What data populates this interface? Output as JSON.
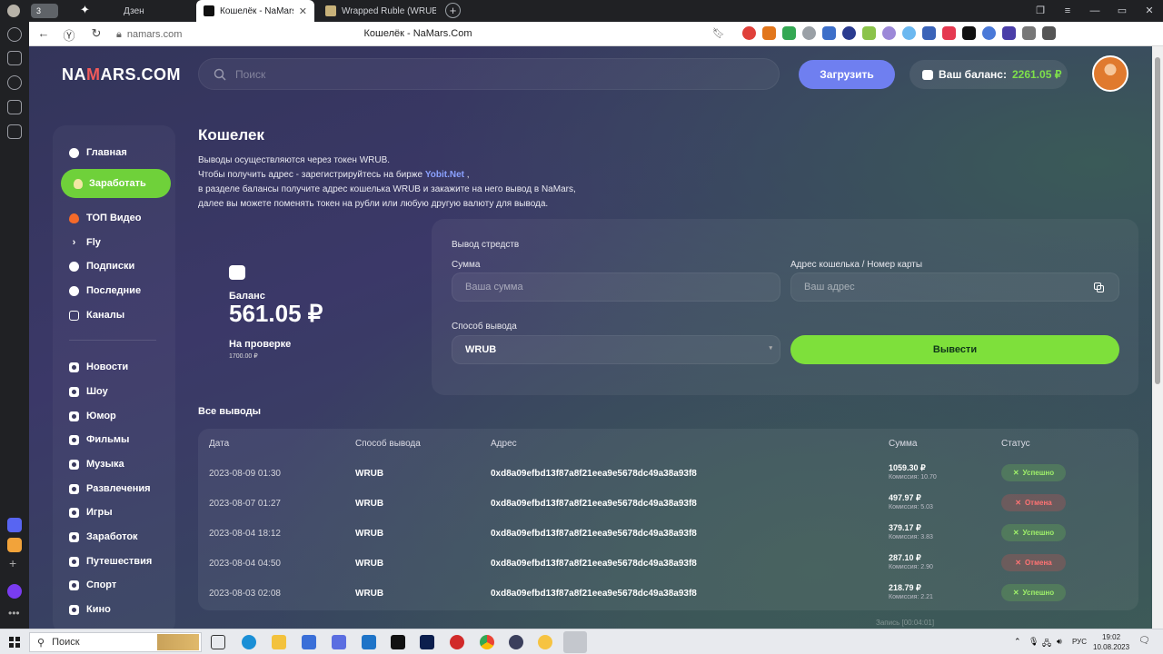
{
  "browser": {
    "tab_count": "3",
    "tabs": [
      {
        "title": "Дзен"
      },
      {
        "title": "Кошелёк - NaMars.Com"
      },
      {
        "title": "Wrapped Ruble (WRUB) To"
      }
    ],
    "url": "namars.com",
    "page_title": "Кошелёк - NaMars.Com"
  },
  "header": {
    "logo_prefix": "NA",
    "logo_accent": "M",
    "logo_suffix": "ARS.COM",
    "search_placeholder": "Поиск",
    "upload_label": "Загрузить",
    "balance_label": "Ваш баланс:",
    "balance_value": "2261.05 ₽"
  },
  "sidebar": {
    "items": [
      {
        "label": "Главная",
        "icon": "home-icon"
      },
      {
        "label": "Заработать",
        "icon": "money-bag-icon"
      },
      {
        "label": "ТОП Видео",
        "icon": "fire-icon"
      },
      {
        "label": "Fly",
        "icon": "chevron-right-icon"
      },
      {
        "label": "Подписки",
        "icon": "subscriptions-icon"
      },
      {
        "label": "Последние",
        "icon": "clock-icon"
      },
      {
        "label": "Каналы",
        "icon": "channels-icon"
      }
    ],
    "categories": [
      "Новости",
      "Шоу",
      "Юмор",
      "Фильмы",
      "Музыка",
      "Развлечения",
      "Игры",
      "Заработок",
      "Путешествия",
      "Спорт",
      "Кино"
    ]
  },
  "main": {
    "title": "Кошелек",
    "desc_1": "Выводы осуществляются через токен WRUB.",
    "desc_2a": "Чтобы получить адрес - зарегистрируйтесь на бирже",
    "desc_2_link": "Yobit.Net",
    "desc_2b": ",",
    "desc_3": "в разделе балансы получите адрес кошелька WRUB и закажите на него вывод в NaMars,",
    "desc_4": "далее вы можете поменять токен на рубли или любую другую валюту для вывода.",
    "balance_label": "Баланс",
    "balance_value": "561.05 ₽",
    "check_label": "На проверке",
    "check_value": "1700.00 ₽"
  },
  "withdraw": {
    "title": "Вывод стредств",
    "amount_label": "Сумма",
    "amount_placeholder": "Ваша сумма",
    "address_label": "Адрес кошелька / Номер карты",
    "address_placeholder": "Ваш адрес",
    "method_label": "Способ вывода",
    "method_value": "WRUB",
    "submit_label": "Вывести"
  },
  "history": {
    "title": "Все выводы",
    "columns": [
      "Дата",
      "Способ вывода",
      "Адрес",
      "Сумма",
      "Статус"
    ],
    "rows": [
      {
        "date": "2023-08-09 01:30",
        "method": "WRUB",
        "address": "0xd8a09efbd13f87a8f21eea9e5678dc49a38a93f8",
        "amount": "1059.30 ₽",
        "fee": "Комиссия: 10.70",
        "status": "Успешно",
        "ok": true
      },
      {
        "date": "2023-08-07 01:27",
        "method": "WRUB",
        "address": "0xd8a09efbd13f87a8f21eea9e5678dc49a38a93f8",
        "amount": "497.97 ₽",
        "fee": "Комиссия: 5.03",
        "status": "Отмена",
        "ok": false
      },
      {
        "date": "2023-08-04 18:12",
        "method": "WRUB",
        "address": "0xd8a09efbd13f87a8f21eea9e5678dc49a38a93f8",
        "amount": "379.17 ₽",
        "fee": "Комиссия: 3.83",
        "status": "Успешно",
        "ok": true
      },
      {
        "date": "2023-08-04 04:50",
        "method": "WRUB",
        "address": "0xd8a09efbd13f87a8f21eea9e5678dc49a38a93f8",
        "amount": "287.10 ₽",
        "fee": "Комиссия: 2.90",
        "status": "Отмена",
        "ok": false
      },
      {
        "date": "2023-08-03 02:08",
        "method": "WRUB",
        "address": "0xd8a09efbd13f87a8f21eea9e5678dc49a38a93f8",
        "amount": "218.79 ₽",
        "fee": "Комиссия: 2.21",
        "status": "Успешно",
        "ok": true
      }
    ]
  },
  "recording": "Запись [00:04:01]",
  "taskbar": {
    "search_label": "Поиск",
    "lang": "РУС",
    "time": "19:02",
    "date": "10.08.2023"
  },
  "colors": {
    "accent_green": "#7ee03b",
    "accent_blue": "#6f7ff0",
    "link": "#8ba1ff",
    "cancel_red": "#ff7373"
  }
}
